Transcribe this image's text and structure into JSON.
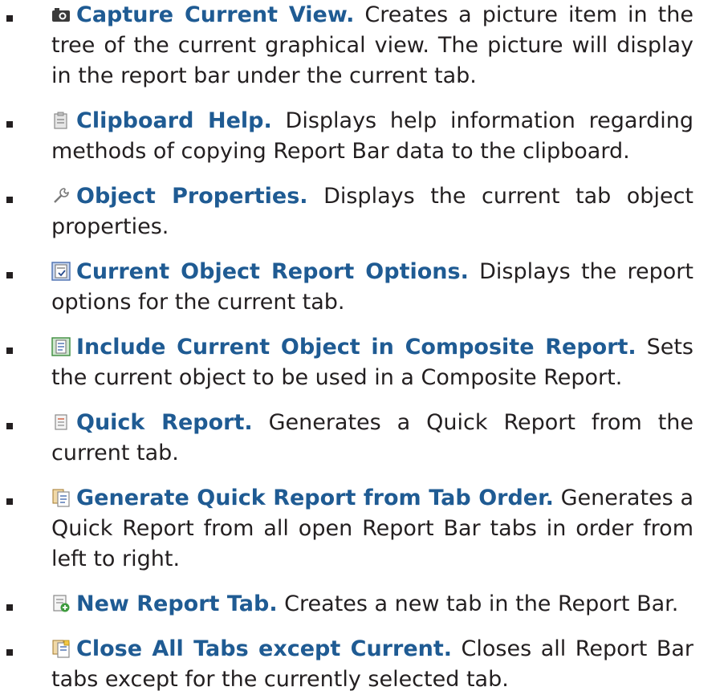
{
  "items": [
    {
      "icon": "camera-icon",
      "title": "Capture Current View.",
      "desc": " Creates a picture item in the tree of the current graphical view. The picture will display in the report bar under the current tab."
    },
    {
      "icon": "clipboard-icon",
      "title": "Clipboard Help.",
      "desc": " Displays help information regarding methods of copying Report Bar data to the clipboard."
    },
    {
      "icon": "wrench-icon",
      "title": "Object Properties.",
      "desc": " Displays the current tab object properties."
    },
    {
      "icon": "report-options-icon",
      "title": "Current Object Report Options.",
      "desc": " Displays the report options for the current tab."
    },
    {
      "icon": "composite-report-icon",
      "title": "Include Current Object in Composite Report.",
      "desc": " Sets the current object to be used in a Composite Report."
    },
    {
      "icon": "quick-report-icon",
      "title": "Quick Report.",
      "desc": " Generates a Quick Report from the current tab."
    },
    {
      "icon": "tab-order-report-icon",
      "title": "Generate Quick Report from Tab Order.",
      "desc": " Generates a Quick Report from all open Report Bar tabs in order from left to right."
    },
    {
      "icon": "new-tab-icon",
      "title": "New Report Tab.",
      "desc": " Creates a new tab in the Report Bar."
    },
    {
      "icon": "close-tabs-icon",
      "title": "Close All Tabs except Current.",
      "desc": " Closes all Report Bar tabs except for the currently selected tab."
    }
  ]
}
